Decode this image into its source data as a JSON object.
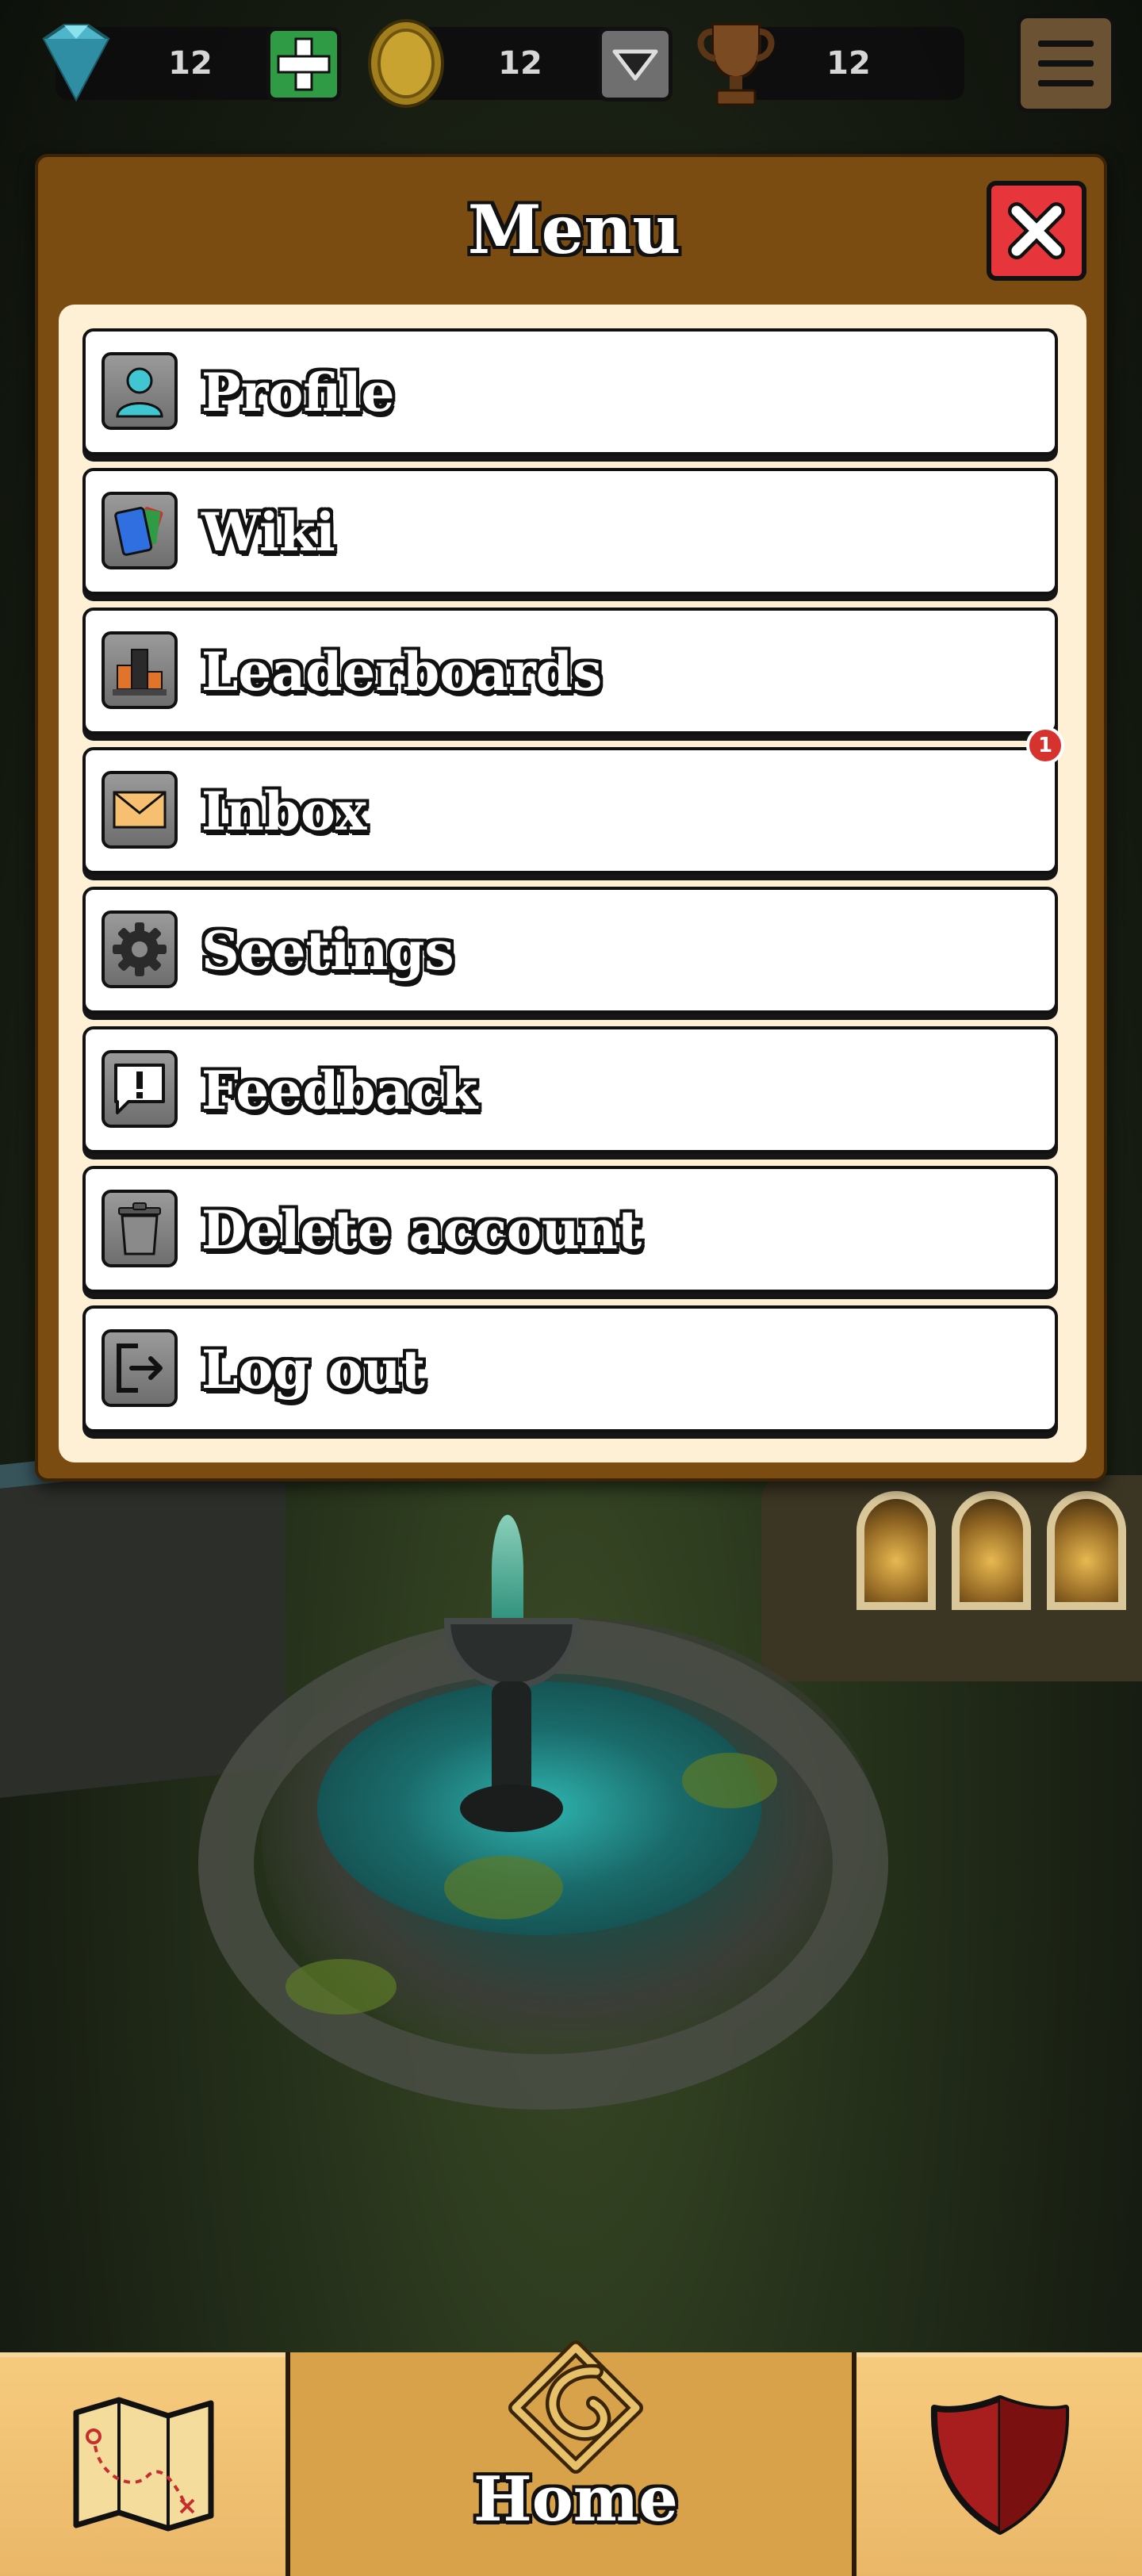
{
  "topbar": {
    "gems": "12",
    "coins": "12",
    "trophies": "12"
  },
  "menu": {
    "title": "Menu",
    "items": [
      {
        "label": "Profile",
        "icon": "person-icon"
      },
      {
        "label": "Wiki",
        "icon": "cards-icon"
      },
      {
        "label": "Leaderboards",
        "icon": "podium-icon"
      },
      {
        "label": "Inbox",
        "icon": "envelope-icon",
        "badge": "1"
      },
      {
        "label": "Seetings",
        "icon": "gear-icon"
      },
      {
        "label": "Feedback",
        "icon": "feedback-icon"
      },
      {
        "label": "Delete account",
        "icon": "trash-icon"
      },
      {
        "label": "Log out",
        "icon": "logout-icon"
      }
    ]
  },
  "nav": {
    "home_label": "Home"
  },
  "colors": {
    "panel": "#7b4c11",
    "panel_inner": "#fdf0d5",
    "close": "#e6353b",
    "badge": "#d6332f",
    "nav_center": "#d8a24a"
  }
}
